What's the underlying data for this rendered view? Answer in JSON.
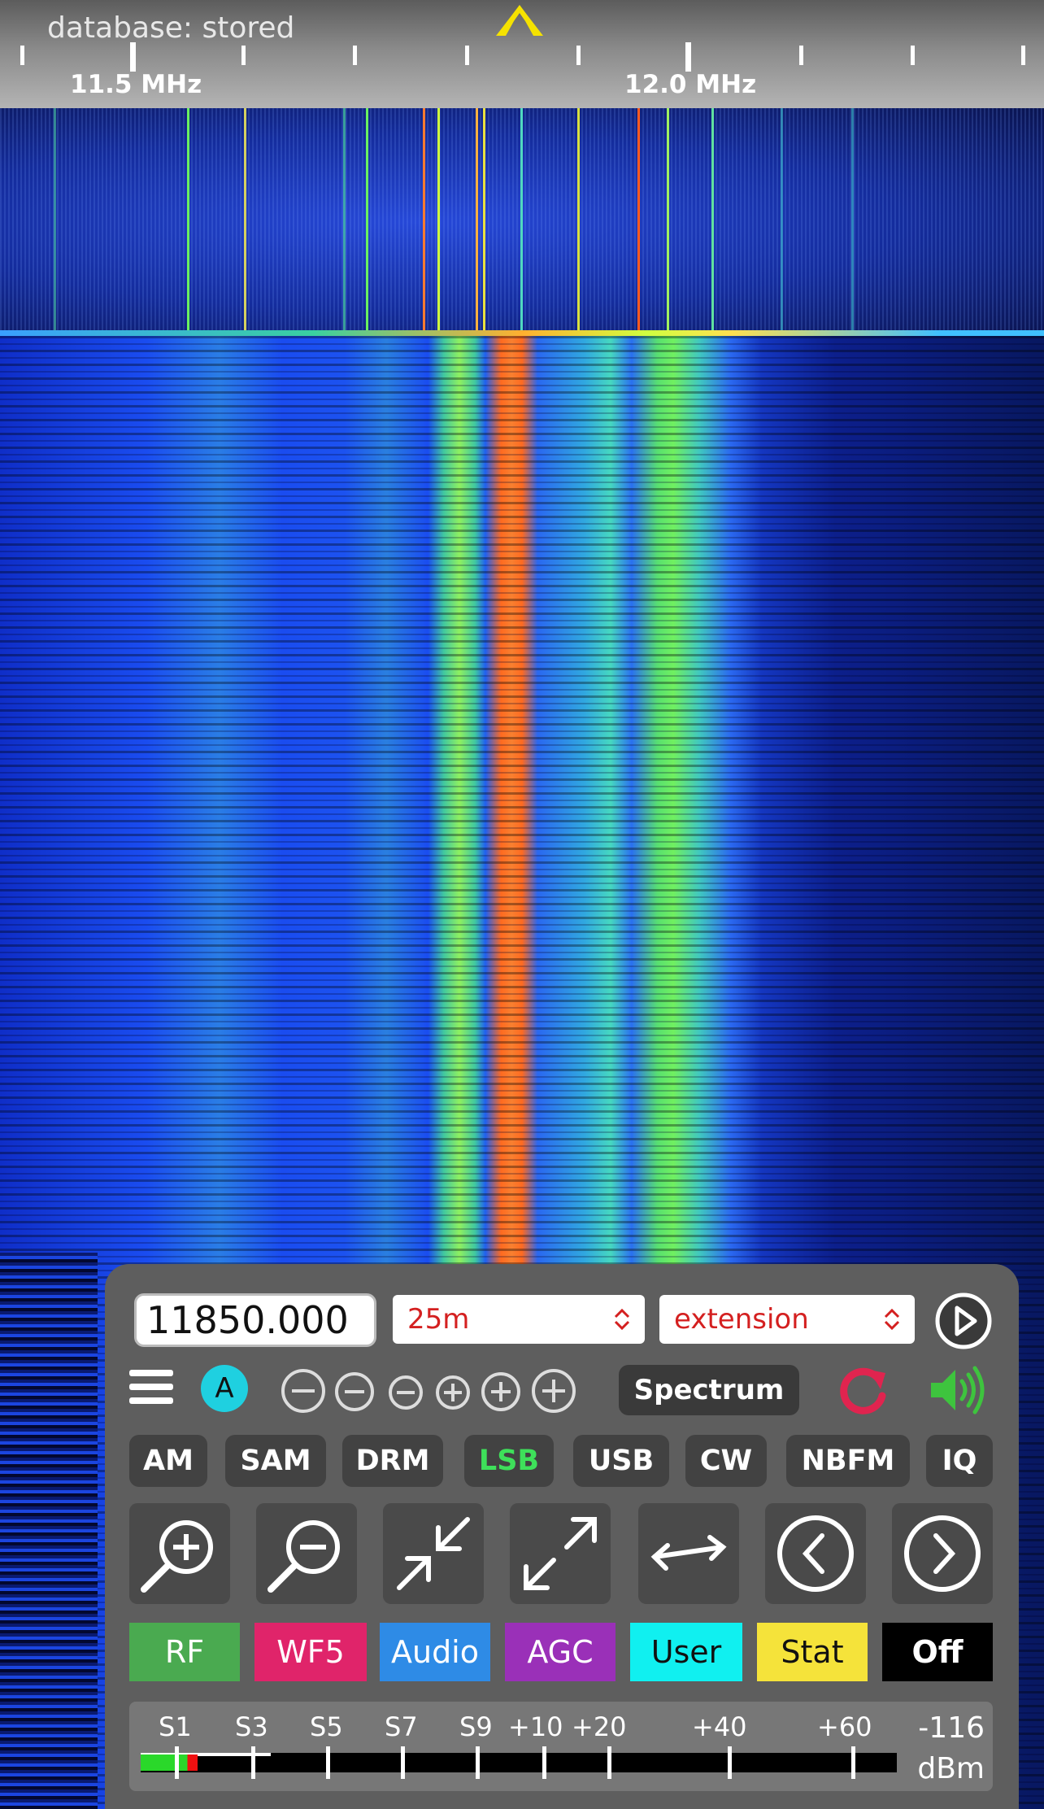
{
  "scale": {
    "database_status": "database: stored",
    "freq_labels": [
      "11.5 MHz",
      "12.0 MHz"
    ]
  },
  "controls": {
    "frequency_value": "11850.000",
    "band": "25m",
    "extension": "extension",
    "mode_indicator": "A",
    "spectrum_label": "Spectrum",
    "modes": [
      "AM",
      "SAM",
      "DRM",
      "LSB",
      "USB",
      "CW",
      "NBFM",
      "IQ"
    ],
    "active_mode": "LSB",
    "tabs": [
      {
        "label": "RF",
        "bg": "#4aaa50",
        "fg": "#ffffff"
      },
      {
        "label": "WF5",
        "bg": "#e0246a",
        "fg": "#ffffff"
      },
      {
        "label": "Audio",
        "bg": "#2e8be6",
        "fg": "#ffffff"
      },
      {
        "label": "AGC",
        "bg": "#9a30b8",
        "fg": "#ffffff"
      },
      {
        "label": "User",
        "bg": "#10f0f0",
        "fg": "#111111"
      },
      {
        "label": "Stat",
        "bg": "#f5e33a",
        "fg": "#111111"
      },
      {
        "label": "Off",
        "bg": "#000000",
        "fg": "#ffffff"
      }
    ]
  },
  "smeter": {
    "labels": [
      "S1",
      "S3",
      "S5",
      "S7",
      "S9",
      "+10",
      "+20",
      "+40",
      "+60"
    ],
    "value": "-116",
    "unit": "dBm",
    "level_fraction": 0.075
  },
  "icons": {
    "play": "play-circle-icon",
    "menu": "hamburger-menu-icon",
    "refresh": "refresh-icon",
    "volume": "speaker-volume-icon",
    "zoom_in": "zoom-in-icon",
    "zoom_out": "zoom-out-icon",
    "zoom_fit": "zoom-fit-icon",
    "zoom_max": "zoom-max-icon",
    "swap": "swap-arrows-icon",
    "prev": "chevron-left-circle-icon",
    "next": "chevron-right-circle-icon"
  },
  "colors": {
    "active_mode": "#3ee05a",
    "select_text": "#d42020",
    "panel_bg": "#5e5e5e",
    "refresh": "#e0244f",
    "volume": "#3ec43e"
  }
}
